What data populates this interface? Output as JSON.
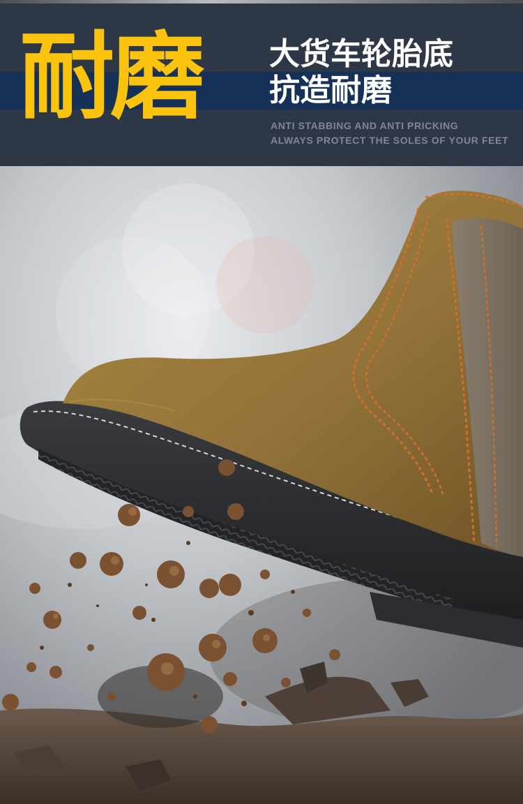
{
  "banner": {
    "title": "耐磨",
    "subtitle_line1": "大货车轮胎底",
    "subtitle_line2": "抗造耐磨",
    "english_line1": "ANTI STABBING AND ANTI PRICKING",
    "english_line2": "ALWAYS PROTECT THE SOLES OF YOUR FEET",
    "colors": {
      "title": "#f9c30e",
      "background": "#2d3745",
      "stripe": "#163158",
      "english": "#7f8893"
    }
  },
  "scene": {
    "subject": "suede chelsea work boot stepping on dirt",
    "colors": {
      "suede": "#9a7a3a",
      "sole": "#2a2b2e",
      "stitch": "#d0702e",
      "dirt": "#7a5232"
    }
  }
}
